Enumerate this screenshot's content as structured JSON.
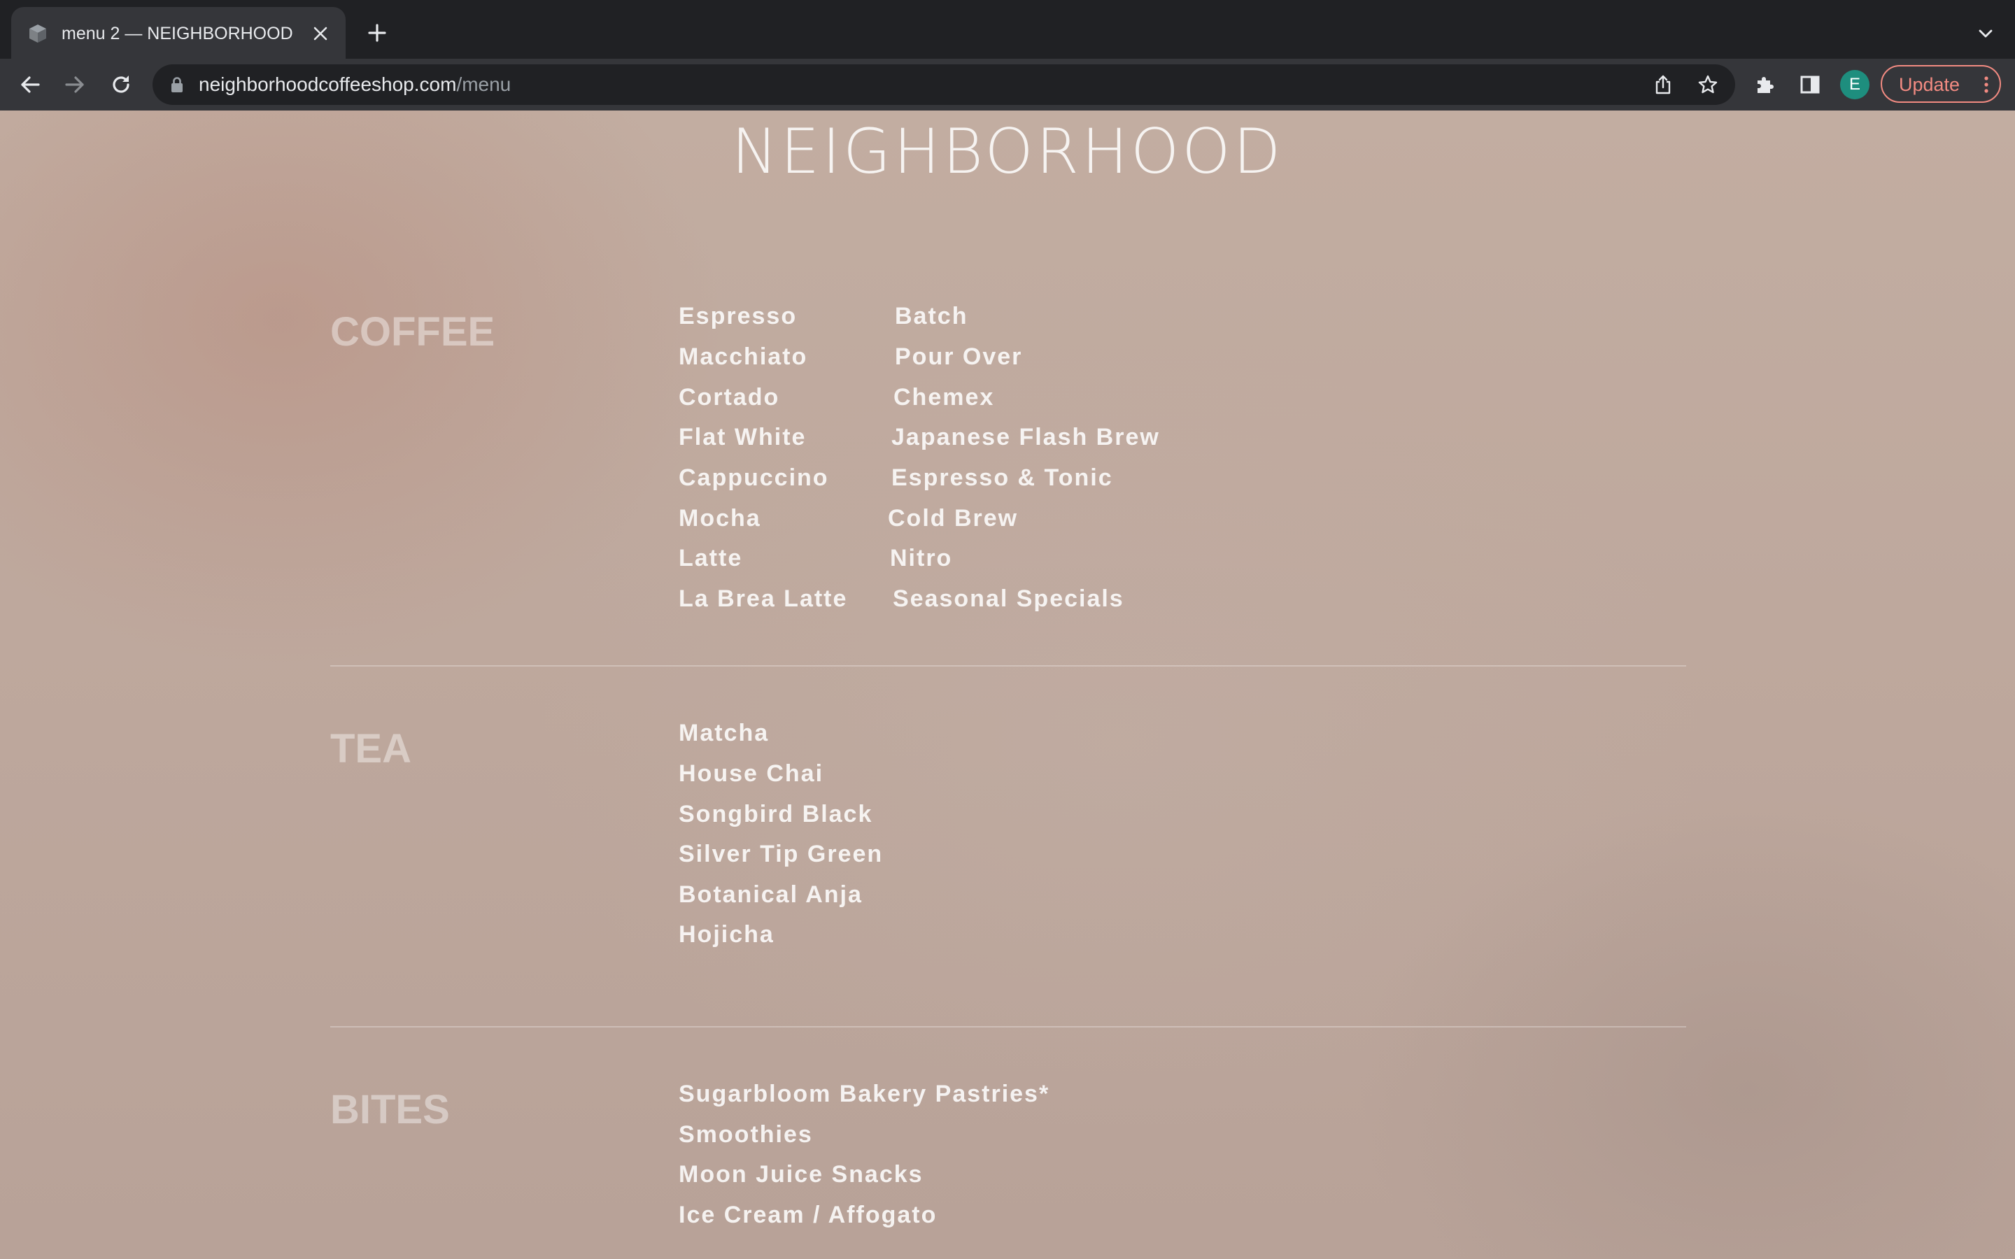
{
  "browser": {
    "tab": {
      "title": "menu 2 — NEIGHBORHOOD"
    },
    "address": {
      "host": "neighborhoodcoffeeshop.com",
      "path": "/menu"
    },
    "profile_initial": "E",
    "update_label": "Update"
  },
  "page": {
    "brand": "NEIGHBORHOOD",
    "sections": [
      {
        "heading": "COFFEE",
        "columns": [
          [
            "Espresso",
            "Macchiato",
            "Cortado",
            "Flat White",
            "Cappuccino",
            "Mocha",
            "Latte",
            "La Brea Latte"
          ],
          [
            "Batch",
            "Pour Over",
            "Chemex",
            "Japanese Flash Brew",
            "Espresso & Tonic",
            "Cold Brew",
            "Nitro",
            "Seasonal Specials"
          ]
        ]
      },
      {
        "heading": "TEA",
        "columns": [
          [
            "Matcha",
            "House Chai",
            "Songbird Black",
            "Silver Tip Green",
            "Botanical Anja",
            "Hojicha"
          ]
        ]
      },
      {
        "heading": "BITES",
        "columns": [
          [
            "Sugarbloom Bakery Pastries*",
            "Smoothies",
            "Moon Juice Snacks",
            "Ice Cream / Affogato"
          ]
        ]
      }
    ]
  },
  "colors": {
    "chrome_dark": "#202124",
    "chrome_toolbar": "#35363a",
    "update_accent": "#f28b82",
    "avatar_bg": "#1e8e7e"
  },
  "icons": [
    "favicon-box-icon",
    "close-icon",
    "plus-icon",
    "chevron-down-icon",
    "back-arrow-icon",
    "forward-arrow-icon",
    "reload-icon",
    "lock-icon",
    "share-icon",
    "star-icon",
    "puzzle-icon",
    "side-panel-icon",
    "kebab-menu-icon"
  ]
}
